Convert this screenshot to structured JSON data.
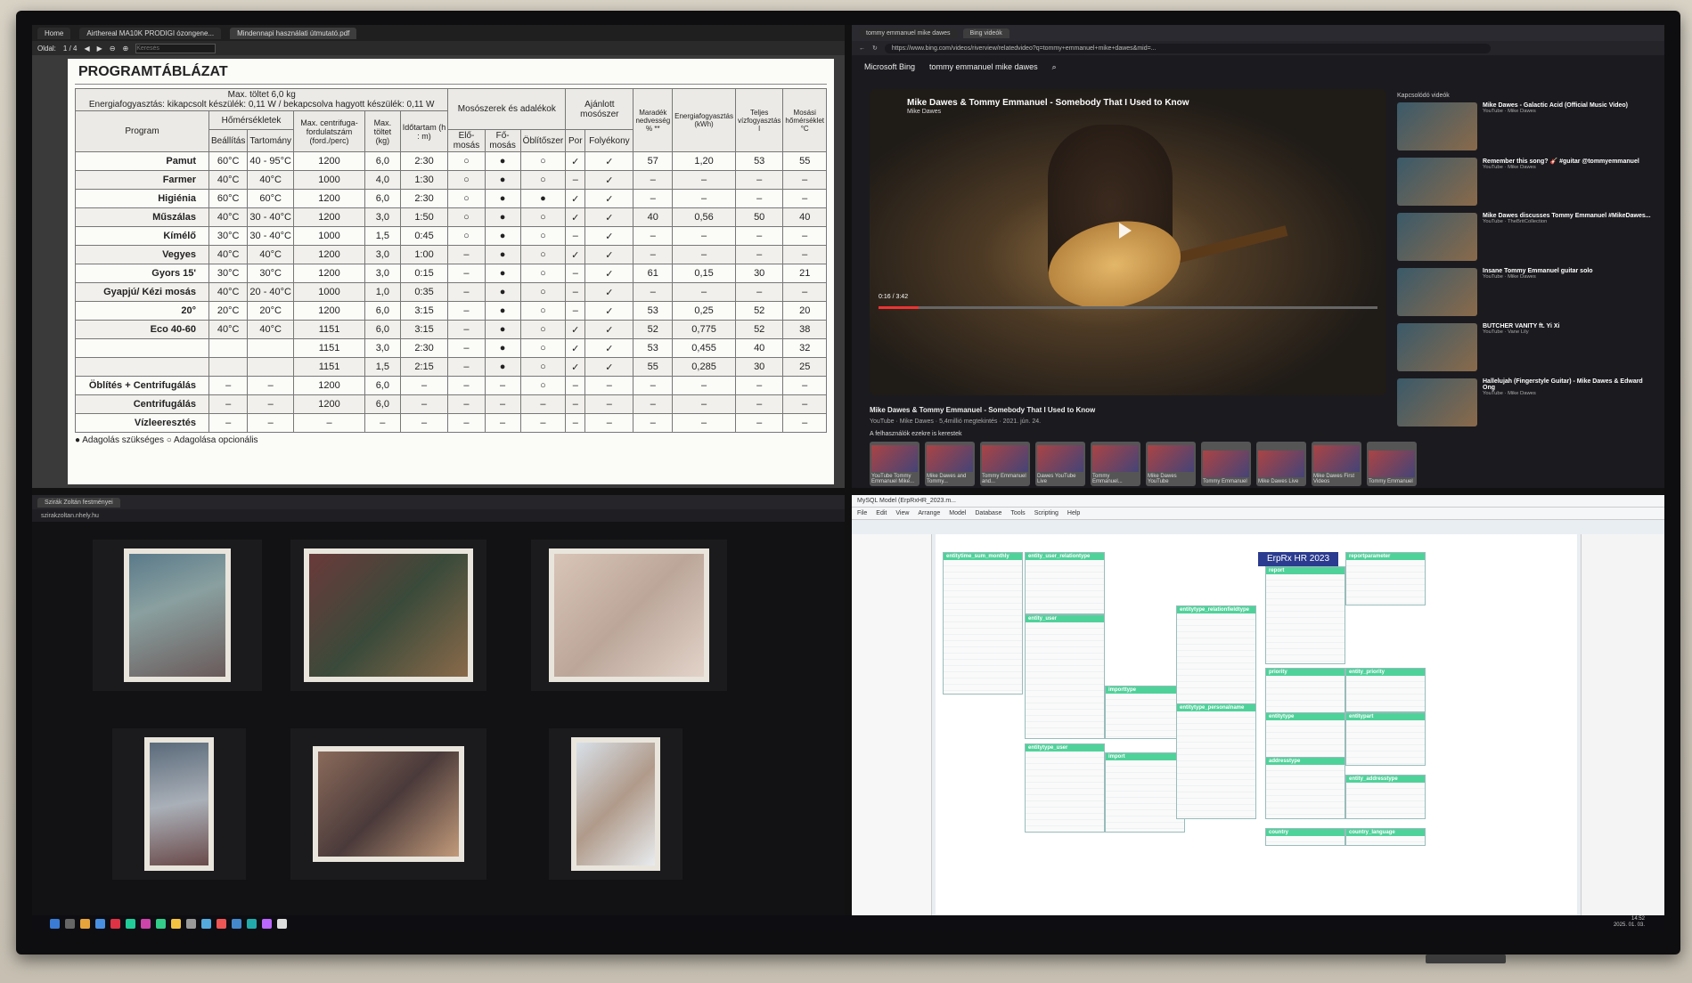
{
  "pdf": {
    "tabs": [
      "Home",
      "Airthereal MA10K PRODIGI ózongene...",
      "Mindennapi használati útmutató.pdf"
    ],
    "toolbar": {
      "page_label": "Oldal:",
      "page": "1 / 4",
      "search_placeholder": "Keresés"
    },
    "title": "PROGRAMTÁBLÁZAT",
    "header_note": "Max. töltet 6,0 kg",
    "energy_note": "Energiafogyasztás: kikapcsolt készülék: 0,11 W / bekapcsolva hagyott készülék: 0,11 W",
    "columns": {
      "program": "Program",
      "temps": "Hőmérsékletek",
      "setting": "Beállítás",
      "range": "Tartomány",
      "spin": "Max. centrifuga-fordulatszám (ford./perc)",
      "load": "Max. töltet (kg)",
      "duration": "Időtartam (h : m)",
      "detergents": "Mosószerek és adalékok",
      "prewash": "Elő-mosás",
      "mainwash": "Fő-mosás",
      "softener": "Öblítőszer",
      "recommended": "Ajánlott mosószer",
      "powder": "Por",
      "liquid": "Folyékony",
      "moisture": "Maradék nedvesség % **",
      "energy": "Energiafogyasztás (kWh)",
      "water": "Teljes vízfogyasztás l",
      "washtemp": "Mosási hőmérséklet °C"
    },
    "rows": [
      [
        "Pamut",
        "60°C",
        "40 - 95°C",
        "1200",
        "6,0",
        "2:30",
        "○",
        "●",
        "○",
        "✓",
        "✓",
        "57",
        "1,20",
        "53",
        "55"
      ],
      [
        "Farmer",
        "40°C",
        "40°C",
        "1000",
        "4,0",
        "1:30",
        "○",
        "●",
        "○",
        "–",
        "✓",
        "–",
        "–",
        "–",
        "–"
      ],
      [
        "Higiénia",
        "60°C",
        "60°C",
        "1200",
        "6,0",
        "2:30",
        "○",
        "●",
        "●",
        "✓",
        "✓",
        "–",
        "–",
        "–",
        "–"
      ],
      [
        "Műszálas",
        "40°C",
        "30 - 40°C",
        "1200",
        "3,0",
        "1:50",
        "○",
        "●",
        "○",
        "✓",
        "✓",
        "40",
        "0,56",
        "50",
        "40"
      ],
      [
        "Kímélő",
        "30°C",
        "30 - 40°C",
        "1000",
        "1,5",
        "0:45",
        "○",
        "●",
        "○",
        "–",
        "✓",
        "–",
        "–",
        "–",
        "–"
      ],
      [
        "Vegyes",
        "40°C",
        "40°C",
        "1200",
        "3,0",
        "1:00",
        "–",
        "●",
        "○",
        "✓",
        "✓",
        "–",
        "–",
        "–",
        "–"
      ],
      [
        "Gyors 15'",
        "30°C",
        "30°C",
        "1200",
        "3,0",
        "0:15",
        "–",
        "●",
        "○",
        "–",
        "✓",
        "61",
        "0,15",
        "30",
        "21"
      ],
      [
        "Gyapjú/ Kézi mosás",
        "40°C",
        "20 - 40°C",
        "1000",
        "1,0",
        "0:35",
        "–",
        "●",
        "○",
        "–",
        "✓",
        "–",
        "–",
        "–",
        "–"
      ],
      [
        "20°",
        "20°C",
        "20°C",
        "1200",
        "6,0",
        "3:15",
        "–",
        "●",
        "○",
        "–",
        "✓",
        "53",
        "0,25",
        "52",
        "20"
      ],
      [
        "Eco 40-60",
        "40°C",
        "40°C",
        "1151",
        "6,0",
        "3:15",
        "–",
        "●",
        "○",
        "✓",
        "✓",
        "52",
        "0,775",
        "52",
        "38"
      ],
      [
        "",
        "",
        "",
        "1151",
        "3,0",
        "2:30",
        "–",
        "●",
        "○",
        "✓",
        "✓",
        "53",
        "0,455",
        "40",
        "32"
      ],
      [
        "",
        "",
        "",
        "1151",
        "1,5",
        "2:15",
        "–",
        "●",
        "○",
        "✓",
        "✓",
        "55",
        "0,285",
        "30",
        "25"
      ],
      [
        "Öblítés + Centrifugálás",
        "–",
        "–",
        "1200",
        "6,0",
        "–",
        "–",
        "–",
        "○",
        "–",
        "–",
        "–",
        "–",
        "–",
        "–"
      ],
      [
        "Centrifugálás",
        "–",
        "–",
        "1200",
        "6,0",
        "–",
        "–",
        "–",
        "–",
        "–",
        "–",
        "–",
        "–",
        "–",
        "–"
      ],
      [
        "Vízleeresztés",
        "–",
        "–",
        "–",
        "–",
        "–",
        "–",
        "–",
        "–",
        "–",
        "–",
        "–",
        "–",
        "–",
        "–"
      ]
    ],
    "legend": "● Adagolás szükséges ○ Adagolása opcionális"
  },
  "bing": {
    "tabs": [
      "tommy emmanuel mike dawes",
      "Bing videók"
    ],
    "url": "https://www.bing.com/videos/riverview/relatedvideo?q=tommy+emmanuel+mike+dawes&mid=...",
    "logo": "Microsoft Bing",
    "query": "tommy emmanuel mike dawes",
    "video_title": "Mike Dawes & Tommy Emmanuel - Somebody That I Used to Know",
    "video_channel": "Mike Dawes",
    "time": "0:16 / 3:42",
    "progress": 0.08,
    "info_title": "Mike Dawes & Tommy Emmanuel - Somebody That I Used to Know",
    "info_meta": "YouTube · Mike Dawes · 5,4millió megtekintés · 2021. jún. 24.",
    "related_title": "Kapcsolódó videók",
    "related": [
      {
        "title": "Mike Dawes - Galactic Acid (Official Music Video)",
        "meta": "YouTube · Mike Dawes"
      },
      {
        "title": "Remember this song? 🎸 #guitar @tommyemmanuel",
        "meta": "YouTube · Mike Dawes"
      },
      {
        "title": "Mike Dawes discusses Tommy Emmanuel #MikeDawes...",
        "meta": "YouTube · TheBritCollection"
      },
      {
        "title": "Insane Tommy Emmanuel guitar solo",
        "meta": "YouTube · Mike Dawes"
      },
      {
        "title": "BUTCHER VANITY ft. Yi Xi",
        "meta": "YouTube · Vane Lily"
      },
      {
        "title": "Hallelujah (Fingerstyle Guitar) - Mike Dawes & Edward Ong",
        "meta": "YouTube · Mike Dawes"
      }
    ],
    "chips_title": "A felhasználók ezekre is kerestek",
    "chips": [
      "YouTube Tommy Emmanuel Mike...",
      "Mike Dawes and Tommy...",
      "Tommy Emmanuel and...",
      "Dawes YouTube Live",
      "Tommy Emmanuel...",
      "Mike Dawes YouTube",
      "Tommy Emmanuel",
      "Mike Dawes Live",
      "Mike Dawes First Videos",
      "Tommy Emmanuel"
    ]
  },
  "gallery": {
    "tab": "Szirák Zoltán festményei",
    "url": "szirakzoltan.nhely.hu"
  },
  "sql": {
    "title": "MySQL Model (ErpRxHR_2023.m...",
    "menu": [
      "File",
      "Edit",
      "View",
      "Arrange",
      "Model",
      "Database",
      "Tools",
      "Scripting",
      "Help"
    ],
    "banner": "ErpRx HR 2023",
    "entities": [
      "entitytime_sum_monthly",
      "entity_user_relationtype",
      "entity_user",
      "entitytype_user",
      "importtype",
      "import",
      "entitytype_relationfieldtype",
      "entitytype_personalname",
      "report",
      "reportparameter",
      "priority",
      "entity_priority",
      "entitytype",
      "entitypart",
      "addresstype",
      "entity_addresstype",
      "country",
      "country_language"
    ]
  },
  "taskbar": {
    "time": "14:52",
    "date": "2025. 01. 03."
  }
}
